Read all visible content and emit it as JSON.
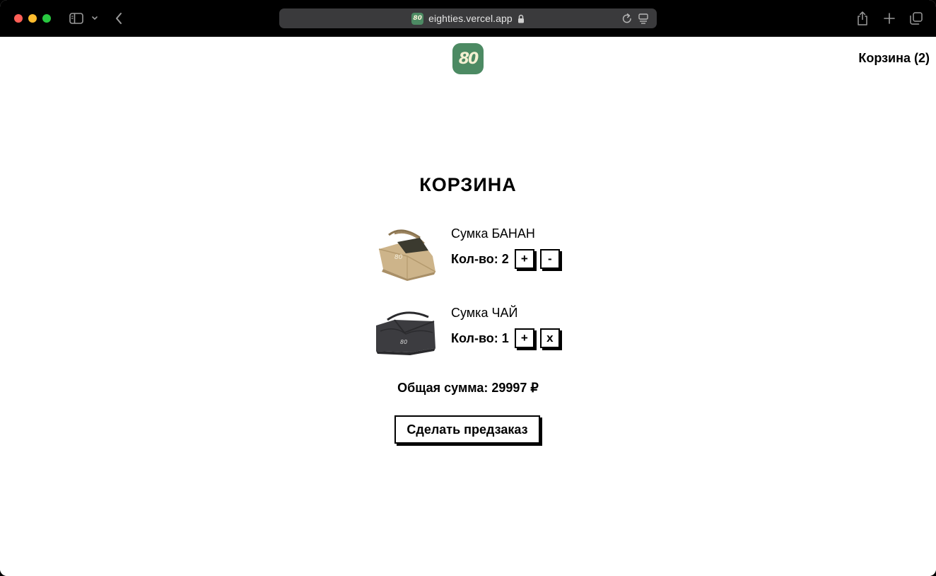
{
  "browser": {
    "url": "eighties.vercel.app",
    "icons": {
      "sidebar": "sidebar-icon",
      "chevron": "chevron-down-icon",
      "back": "back-icon",
      "lock": "lock-icon",
      "reload": "reload-icon",
      "reader": "reader-icon",
      "share": "share-icon",
      "new_tab": "plus-icon",
      "tabs": "tabs-icon"
    },
    "favicon_text": "80"
  },
  "header": {
    "logo_text": "80",
    "cart_link": "Корзина (2)"
  },
  "main": {
    "title": "КОРЗИНА",
    "qty_label": "Кол-во:",
    "items": [
      {
        "name": "Сумка БАНАН",
        "qty": "2",
        "plus": "+",
        "minus": "-"
      },
      {
        "name": "Сумка ЧАЙ",
        "qty": "1",
        "plus": "+",
        "minus": "x"
      }
    ],
    "total": "Общая сумма: 29997 ₽",
    "preorder_button": "Сделать предзаказ"
  },
  "colors": {
    "brand_green": "#4c8a63",
    "logo_text": "#f4f0d2",
    "bag_banan": "#cdb48a",
    "bag_chai": "#3c3c40"
  }
}
